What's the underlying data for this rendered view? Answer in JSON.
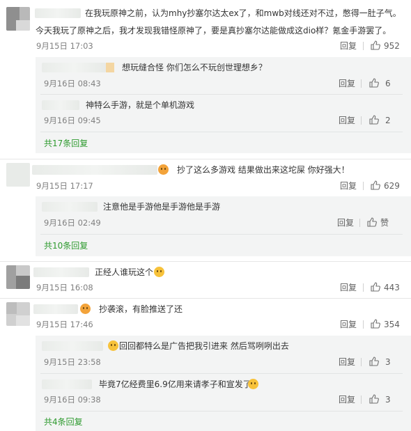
{
  "comments": [
    {
      "text_line1": "在我玩原神之前，认为mhy抄塞尔达太ex了，和mwb对线还对不过，憋得一肚子气。",
      "text_line2": "今天我玩了原神之后，我才发现我错怪原神了，要是真抄塞尔达能做成这dio样？氪金手游罢了。",
      "date": "9月15日 17:03",
      "reply": "回复",
      "likes": "952",
      "replies": [
        {
          "text": "想玩缝合怪 你们怎么不玩创世理想乡？",
          "date": "9月16日 08:43",
          "reply": "回复",
          "likes": "6"
        },
        {
          "text": "神特么手游，就是个单机游戏",
          "date": "9月16日 09:45",
          "reply": "回复",
          "likes": "2"
        }
      ],
      "more": "共17条回复"
    },
    {
      "text": "抄了这么多游戏 结果做出来这坨屎 你好强大！",
      "date": "9月15日 17:17",
      "reply": "回复",
      "likes": "629",
      "replies": [
        {
          "text": "注意他是手游他是手游他是手游",
          "date": "9月16日 02:49",
          "reply": "回复",
          "likes": "赞"
        }
      ],
      "more": "共10条回复"
    },
    {
      "text": "正经人谁玩这个",
      "date": "9月15日 16:08",
      "reply": "回复",
      "likes": "443"
    },
    {
      "text": "抄袭滚，有脸推送了还",
      "date": "9月15日 17:46",
      "reply": "回复",
      "likes": "354",
      "replies": [
        {
          "text": "回回都特么是广告把我引进来 然后骂咧咧出去",
          "date": "9月15日 23:58",
          "reply": "回复",
          "likes": "3"
        },
        {
          "text": "毕竟7亿经费里6.9亿用来请孝子和宣发了",
          "date": "9月16日 09:38",
          "reply": "回复",
          "likes": "3"
        }
      ],
      "more": "共4条回复"
    }
  ],
  "icons": {
    "like": "thumbs-up-icon",
    "emoji": "emoji-icon",
    "avatar": "avatar-image"
  }
}
